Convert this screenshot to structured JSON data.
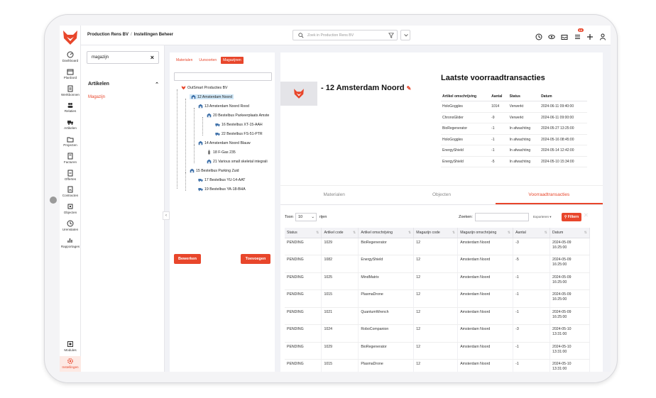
{
  "app": {
    "brand_color": "#e8462b",
    "breadcrumb": [
      "Production Rens BV",
      "Instellingen Beheer"
    ],
    "search_placeholder": "Zoek in Production Rens BV",
    "notification_count": "10"
  },
  "rail": {
    "items": [
      {
        "label": "Dashboard",
        "icon": "dashboard-icon"
      },
      {
        "label": "Planbord",
        "icon": "calendar-icon"
      },
      {
        "label": "Werkbonnen",
        "icon": "document-icon"
      },
      {
        "label": "Relaties",
        "icon": "people-icon"
      },
      {
        "label": "Artikelen",
        "icon": "truck-icon"
      },
      {
        "label": "Projecten",
        "icon": "folder-icon"
      },
      {
        "label": "Facturen",
        "icon": "invoice-icon"
      },
      {
        "label": "Offertes",
        "icon": "quote-icon"
      },
      {
        "label": "Contracten",
        "icon": "contract-icon"
      },
      {
        "label": "Objecten",
        "icon": "object-icon"
      },
      {
        "label": "Urenstaten",
        "icon": "clock-icon"
      },
      {
        "label": "Rapportages",
        "icon": "chart-icon"
      }
    ],
    "bottom": [
      {
        "label": "Modules",
        "icon": "modules-icon"
      },
      {
        "label": "Instellingen",
        "icon": "settings-icon"
      }
    ]
  },
  "side": {
    "search_value": "magazijn",
    "section": "Artikelen",
    "link": "Magazijn"
  },
  "tree_panel": {
    "tabs": [
      "Materialen",
      "Uursoorten",
      "Magazijnen"
    ],
    "nodes": [
      "OutSmart Producties BV",
      "12 Amsterdam Noord",
      "13 Amsterdam Noord Rood",
      "20 Bestelbus Parkeerplaats Amste",
      "16 Bestelbus XT-15-AAH",
      "22 Bestelbus FS-51-PTR",
      "14 Amsterdam Noord Blauw",
      "18 F-Gas 235",
      "21 Various small skeletal integrali",
      "15 Bestelbus Parking Zuid",
      "17 Bestelbus YU-14-AAT",
      "19 Bestelbus YA-18-BHA"
    ],
    "edit_button": "Bewerken",
    "add_button": "Toevoegen"
  },
  "detail": {
    "title": "- 12 Amsterdam Noord",
    "tx_title": "Laatste voorraadtransacties",
    "tx_headers": [
      "Artikel omschrijving",
      "Aantal",
      "Status",
      "Datum"
    ],
    "tx_rows": [
      [
        "HoloGoggles",
        "1014",
        "Verwerkt",
        "2024-06-11 09:40:00"
      ],
      [
        "ChronoGlider",
        "-9",
        "Verwerkt",
        "2024-06-11 09:00:00"
      ],
      [
        "BioRegenerator",
        "-1",
        "In afwachting",
        "2024-05-27 13:25:00"
      ],
      [
        "HoloGoggles",
        "-1",
        "In afwachting",
        "2024-05-16 08:45:00"
      ],
      [
        "EnergyShield",
        "-1",
        "In afwachting",
        "2024-05-14 12:42:00"
      ],
      [
        "EnergyShield",
        "-5",
        "In afwachting",
        "2024-05-10 15:34:00"
      ]
    ],
    "tabs": [
      "Materialen",
      "Objecten",
      "Voorraadtransacties"
    ],
    "toon": "Toon",
    "page_size": "10",
    "rijen": "rijen",
    "zoeken": "Zoeken:",
    "exporteren": "Exporteren",
    "filteren": "Filtern",
    "table_headers": [
      "Status",
      "Artikel code",
      "Artikel omschrijving",
      "Magazijn code",
      "Magazijn omschrijving",
      "Aantal",
      "Datum"
    ],
    "table_rows": [
      [
        "PENDING",
        "1029",
        "BioRegenerator",
        "12",
        "Amsterdam Noord",
        "-3",
        "2024-05-09",
        "16:25:00"
      ],
      [
        "PENDING",
        "1082",
        "EnergyShield",
        "12",
        "Amsterdam Noord",
        "-5",
        "2024-05-09",
        "16:25:00"
      ],
      [
        "PENDING",
        "1025",
        "MindMatrix",
        "12",
        "Amsterdam Noord",
        "-1",
        "2024-05-09",
        "16:25:00"
      ],
      [
        "PENDING",
        "1015",
        "PlasmaDrone",
        "12",
        "Amsterdam Noord",
        "-1",
        "2024-05-09",
        "16:25:00"
      ],
      [
        "PENDING",
        "1021",
        "QuantumWrench",
        "12",
        "Amsterdam Noord",
        "-1",
        "2024-05-09",
        "16:25:00"
      ],
      [
        "PENDING",
        "1024",
        "RoboCompanion",
        "12",
        "Amsterdam Noord",
        "-3",
        "2024-05-10",
        "13:31:00"
      ],
      [
        "PENDING",
        "1029",
        "BioRegenerator",
        "12",
        "Amsterdam Noord",
        "-1",
        "2024-05-10",
        "13:31:00"
      ],
      [
        "PENDING",
        "1015",
        "PlasmaDrone",
        "12",
        "Amsterdam Noord",
        "-1",
        "2024-05-10",
        "13:31:00"
      ]
    ]
  }
}
